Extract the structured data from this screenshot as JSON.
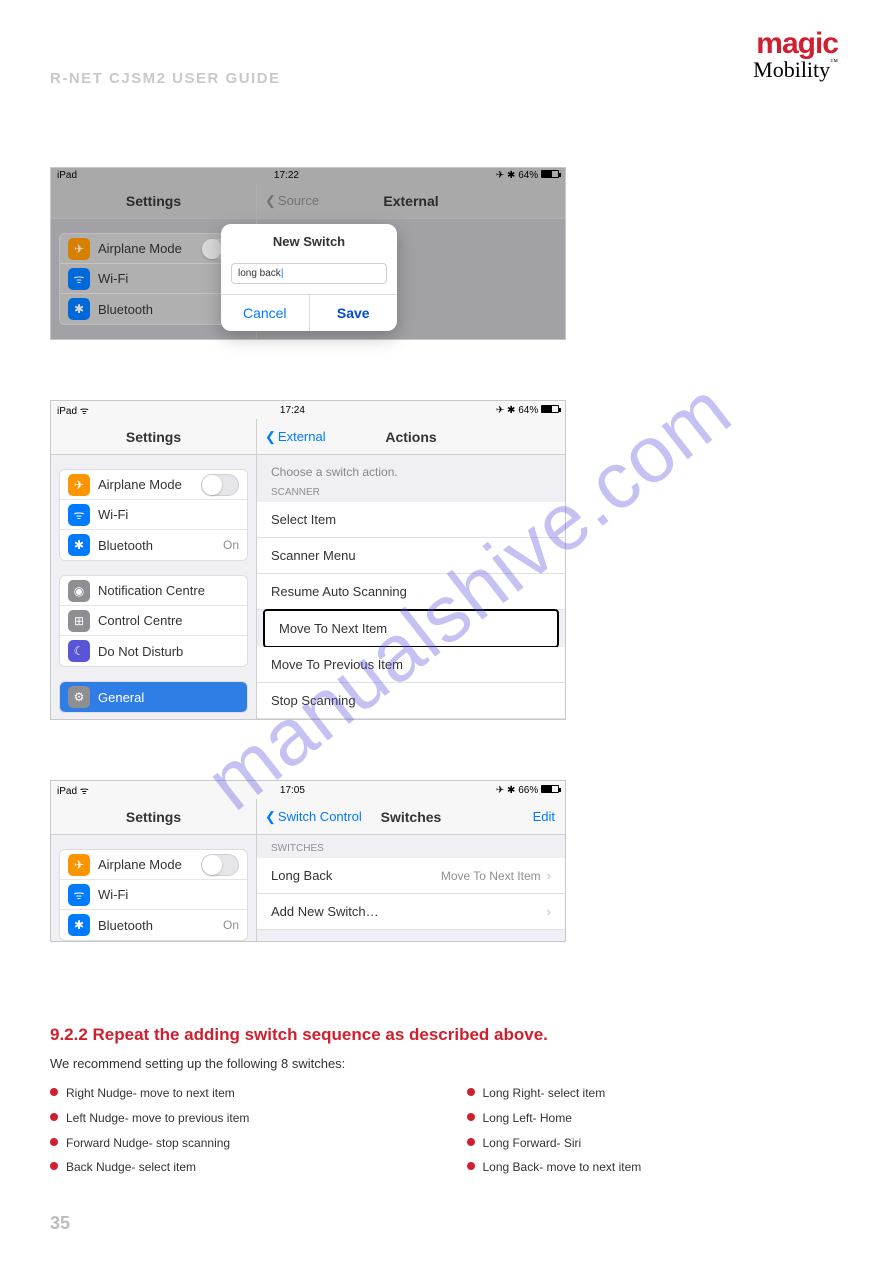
{
  "header": {
    "guide_title": "R-NET CJSM2 USER GUIDE",
    "logo_top": "magic",
    "logo_bottom": "Mobility",
    "tm": "™"
  },
  "watermark": "manualshive.com",
  "page_number": "35",
  "shot1": {
    "device": "iPad",
    "time": "17:22",
    "battery": "64%",
    "settings_title": "Settings",
    "back_label": "Source",
    "panel_title": "External",
    "sidebar": {
      "airplane": "Airplane Mode",
      "wifi": "Wi-Fi",
      "bluetooth": "Bluetooth"
    },
    "modal": {
      "title": "New Switch",
      "input_value": "long back",
      "cancel": "Cancel",
      "save": "Save"
    }
  },
  "shot2": {
    "device": "iPad",
    "time": "17:24",
    "battery": "64%",
    "settings_title": "Settings",
    "back_label": "External",
    "panel_title": "Actions",
    "instruction": "Choose a switch action.",
    "section": "SCANNER",
    "rows": {
      "r1": "Select Item",
      "r2": "Scanner Menu",
      "r3": "Resume Auto Scanning",
      "r4": "Move To Next Item",
      "r5": "Move To Previous Item",
      "r6": "Stop Scanning"
    },
    "sidebar": {
      "airplane": "Airplane Mode",
      "wifi": "Wi-Fi",
      "bluetooth": "Bluetooth",
      "bt_val": "On",
      "notif": "Notification Centre",
      "cc": "Control Centre",
      "dnd": "Do Not Disturb",
      "general": "General"
    }
  },
  "shot3": {
    "device": "iPad",
    "time": "17:05",
    "battery": "66%",
    "settings_title": "Settings",
    "back_label": "Switch Control",
    "panel_title": "Switches",
    "edit": "Edit",
    "section": "SWITCHES",
    "rows": {
      "long_back": "Long Back",
      "long_back_detail": "Move To Next Item",
      "add_new": "Add New Switch…"
    },
    "sidebar": {
      "airplane": "Airplane Mode",
      "wifi": "Wi-Fi",
      "bluetooth": "Bluetooth",
      "bt_val": "On"
    }
  },
  "bottom": {
    "heading": "9.2.2 Repeat the adding switch sequence as described above.",
    "intro": "We recommend setting up the following 8 switches:",
    "left": {
      "i1": "Right Nudge- move to next item",
      "i2": "Left Nudge- move to previous item",
      "i3": "Forward Nudge- stop scanning",
      "i4": "Back Nudge- select item"
    },
    "right": {
      "i1": "Long Right- select item",
      "i2": "Long Left- Home",
      "i3": "Long Forward- Siri",
      "i4": "Long Back- move to next item"
    }
  }
}
